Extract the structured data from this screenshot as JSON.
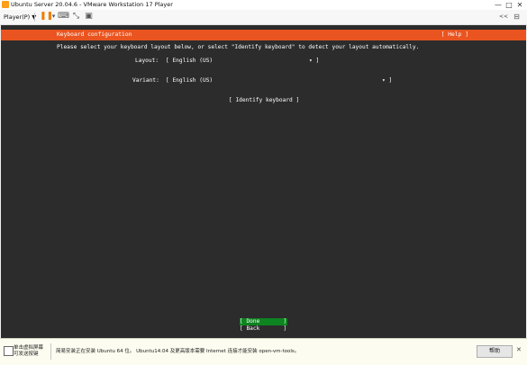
{
  "window": {
    "title": "Ubuntu Server 20.04.6 - VMware Workstation 17 Player",
    "controls": {
      "minimize": "—",
      "maximize": "□",
      "close": "✕"
    }
  },
  "toolbar": {
    "player_menu": "Player(P) ▼",
    "pause_icon": "pause-icon",
    "right_label": "<<"
  },
  "installer": {
    "header_title": "Keyboard configuration",
    "help": "[ Help ]",
    "instruction": "Please select your keyboard layout below, or select \"Identify keyboard\" to detect your layout automatically.",
    "layout_label": "Layout:",
    "layout_value": "[ English (US)",
    "layout_suffix": "▾ ]",
    "variant_label": "Variant:",
    "variant_value": "[ English (US)",
    "variant_suffix": "▾ ]",
    "identify_button": "[ Identify keyboard ]",
    "done_button": "[ Done       ]",
    "back_button": "[ Back       ]",
    "colors": {
      "accent": "#e95420",
      "background": "#2c2c2c",
      "done": "#0e8420"
    }
  },
  "statusbar": {
    "hint": "单击虚拟屏幕\n可发送按键",
    "message": "简易安装正在安装 Ubuntu 64 位。 Ubuntu14.04 及更高版本需要 Internet 连接才能安装 open-vm-tools。",
    "help_button": "帮助",
    "close": "✕"
  }
}
